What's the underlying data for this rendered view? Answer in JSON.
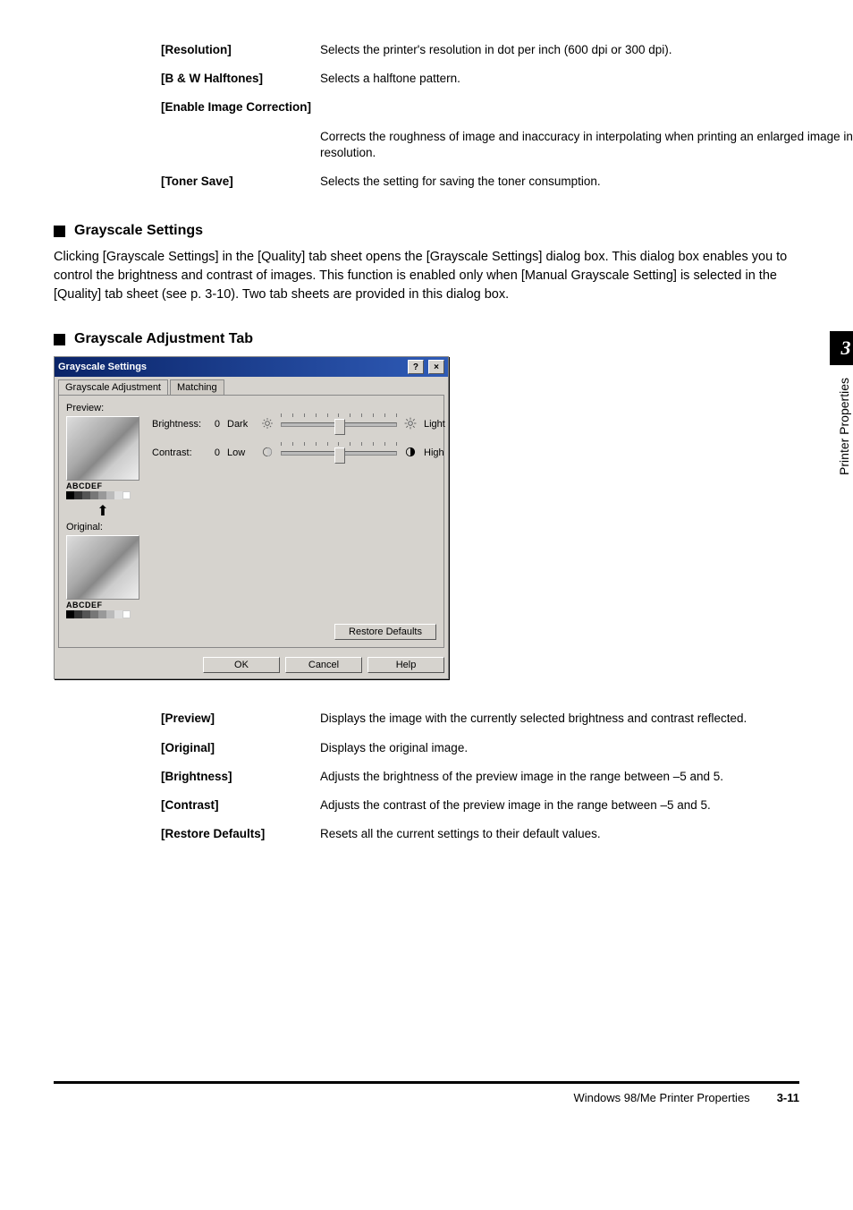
{
  "top_defs": [
    {
      "term": "[Resolution]",
      "desc": "Selects the printer's resolution in dot per inch (600 dpi or 300 dpi)."
    },
    {
      "term": "[B & W Halftones]",
      "desc": "Selects a halftone pattern."
    },
    {
      "term": "[Enable Image Correction]",
      "desc": ""
    },
    {
      "term": "",
      "desc": "Corrects the roughness of image and inaccuracy in interpolating when printing an enlarged image in low-resolution."
    },
    {
      "term": "[Toner Save]",
      "desc": "Selects the setting for saving the toner consumption."
    }
  ],
  "sec1_title": "Grayscale Settings",
  "sec1_body": "Clicking [Grayscale Settings] in the [Quality] tab sheet opens the [Grayscale Settings] dialog box. This dialog box enables you to control the brightness and contrast of images. This function is enabled only when [Manual Grayscale Setting] is selected in the [Quality] tab sheet (see p. 3-10). Two tab sheets are provided in this dialog box.",
  "sec2_title": "Grayscale Adjustment Tab",
  "dialog": {
    "title": "Grayscale Settings",
    "tabs": [
      "Grayscale Adjustment",
      "Matching"
    ],
    "preview_label": "Preview:",
    "thumb_text": "ABCDEF",
    "original_label": "Original:",
    "brightness_label": "Brightness:",
    "brightness_val": "0",
    "brightness_low": "Dark",
    "brightness_high": "Light",
    "contrast_label": "Contrast:",
    "contrast_val": "0",
    "contrast_low": "Low",
    "contrast_high": "High",
    "restore": "Restore Defaults",
    "ok": "OK",
    "cancel": "Cancel",
    "help": "Help"
  },
  "bottom_defs": [
    {
      "term": "[Preview]",
      "desc": "Displays the image with the currently selected brightness and contrast reflected."
    },
    {
      "term": "[Original]",
      "desc": "Displays the original image."
    },
    {
      "term": "[Brightness]",
      "desc": "Adjusts the brightness of the preview image in the range between –5 and 5."
    },
    {
      "term": "[Contrast]",
      "desc": "Adjusts the contrast of the preview image in the range between –5 and 5."
    },
    {
      "term": "[Restore Defaults]",
      "desc": "Resets all the current settings to their default values."
    }
  ],
  "side_num": "3",
  "side_text": "Printer Properties",
  "footer_text": "Windows 98/Me Printer Properties",
  "footer_page": "3-11"
}
